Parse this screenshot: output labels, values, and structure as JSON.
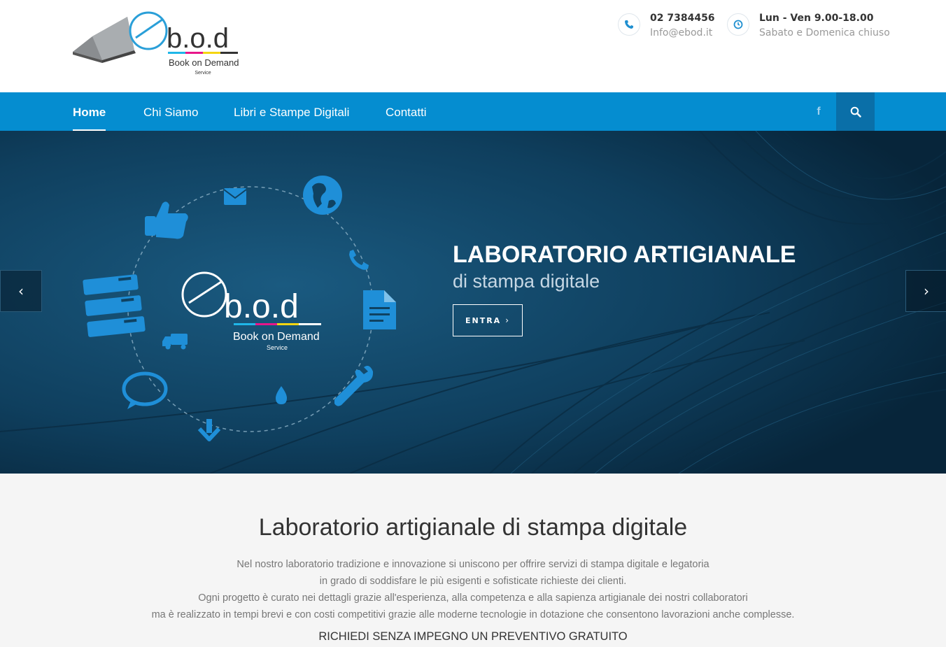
{
  "header": {
    "logo": {
      "letters": "e",
      "letters_rest": "b.o.d",
      "tagline": "Book on Demand",
      "tagline_small": "Service",
      "color_stripe": [
        "#1fb6e8",
        "#e8168a",
        "#f5d511",
        "#333333"
      ]
    },
    "phone": {
      "icon": "phone-icon",
      "number": "02 7384456",
      "email": "Info@ebod.it"
    },
    "hours": {
      "icon": "clock-icon",
      "weekdays": "Lun - Ven 9.00-18.00",
      "weekend": "Sabato e Domenica chiuso"
    }
  },
  "nav": {
    "items": [
      {
        "label": "Home",
        "active": true
      },
      {
        "label": "Chi Siamo",
        "active": false
      },
      {
        "label": "Libri e Stampe Digitali",
        "active": false
      },
      {
        "label": "Contatti",
        "active": false
      }
    ],
    "facebook_icon": "facebook-icon",
    "facebook_glyph": "f",
    "search_icon": "search-icon",
    "accent": "#058dd0"
  },
  "hero": {
    "title": "LABORATORIO ARTIGIANALE",
    "subtitle": "di stampa digitale",
    "button": "ENTRA",
    "button_chevron": "›",
    "prev_glyph": "‹",
    "next_glyph": "›",
    "logo": {
      "letters": "e",
      "letters_rest": "b.o.d",
      "tagline": "Book on Demand",
      "tagline_small": "Service"
    },
    "icons": [
      "like-icon",
      "mail-icon",
      "globe-icon",
      "phone-icon",
      "document-icon",
      "wrench-icon",
      "drop-icon",
      "download-icon",
      "chat-icon",
      "truck-icon",
      "server-icon"
    ]
  },
  "intro": {
    "title": "Laboratorio artigianale di stampa digitale",
    "paragraph": [
      "Nel nostro laboratorio tradizione e innovazione si uniscono per offrire servizi di stampa digitale e legatoria",
      "in grado di soddisfare le più esigenti e sofisticate richieste dei clienti.",
      "Ogni progetto è curato nei dettagli grazie all'esperienza, alla competenza e alla sapienza artigianale dei nostri collaboratori",
      "ma è realizzato in tempi brevi e con costi competitivi grazie alle moderne tecnologie in dotazione che consentono lavorazioni anche complesse."
    ],
    "cta": "RICHIEDI SENZA IMPEGNO UN PREVENTIVO GRATUITO"
  }
}
